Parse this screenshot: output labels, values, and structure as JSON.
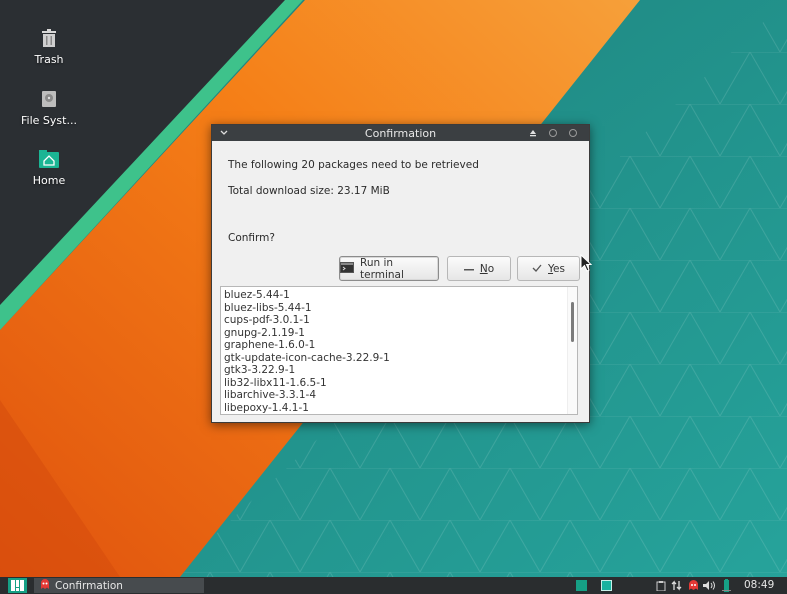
{
  "desktop": {
    "icons": [
      {
        "label": "Trash",
        "icon": "trash-icon"
      },
      {
        "label": "File Syst...",
        "icon": "drive-icon"
      },
      {
        "label": "Home",
        "icon": "home-folder-icon"
      }
    ]
  },
  "dialog": {
    "title": "Confirmation",
    "message": "The following 20 packages need to be retrieved",
    "download_size": "Total download size: 23.17 MiB",
    "confirm_prompt": "Confirm?",
    "buttons": {
      "run_in_terminal": "Run in terminal",
      "no_mnemonic": "N",
      "no_rest": "o",
      "yes_mnemonic": "Y",
      "yes_rest": "es"
    },
    "packages": [
      "bluez-5.44-1",
      "bluez-libs-5.44-1",
      "cups-pdf-3.0.1-1",
      "gnupg-2.1.19-1",
      "graphene-1.6.0-1",
      "gtk-update-icon-cache-3.22.9-1",
      "gtk3-3.22.9-1",
      "lib32-libx11-1.6.5-1",
      "libarchive-3.3.1-4",
      "libepoxy-1.4.1-1"
    ]
  },
  "taskbar": {
    "task_label": "Confirmation",
    "clock": "08:49"
  },
  "colors": {
    "accent": "#16a085",
    "wallpaper_orange": "#f07d1a",
    "wallpaper_teal": "#1f8f88",
    "wallpaper_dark": "#2b2f33"
  }
}
